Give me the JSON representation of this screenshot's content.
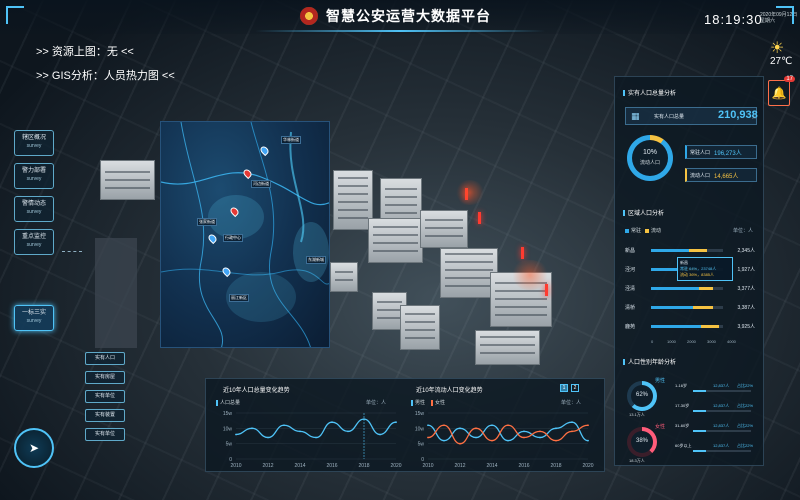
{
  "header": {
    "title": "智慧公安运营大数据平台",
    "time": "18:19:30",
    "date_line1": "2020年09月12日",
    "date_line2": "星期六",
    "temperature": "27℃",
    "alert_count": "17"
  },
  "info": {
    "resource_line": ">> 资源上图：无 <<",
    "gis_line": ">> GIS分析：人员热力图 <<"
  },
  "left_nav": [
    {
      "label": "辖区概况",
      "sub": "survey"
    },
    {
      "label": "警力部署",
      "sub": "survey"
    },
    {
      "label": "警情动态",
      "sub": "survey"
    },
    {
      "label": "重点监控",
      "sub": "survey"
    },
    {
      "label": "一标三实",
      "sub": "survey"
    }
  ],
  "sub_nav": [
    "实有人口",
    "实有房屋",
    "实有单位",
    "实有装置",
    "实有单位"
  ],
  "map": {
    "labels": [
      "华林街道",
      "河边街道",
      "张家街道",
      "行政中心",
      "东湖新城",
      "丽江新区"
    ]
  },
  "charts": {
    "left": {
      "title": "近10年人口总量变化趋势",
      "legend": "人口总量",
      "unit": "单位：人",
      "y_ticks": [
        "15w",
        "10w",
        "5w",
        "0"
      ],
      "x_ticks": [
        "2010",
        "2012",
        "2014",
        "2016",
        "2018",
        "2020"
      ]
    },
    "right": {
      "title": "近10年流动人口变化趋势",
      "legend_male": "男性",
      "legend_female": "女性",
      "unit": "单位：人",
      "page1": "1",
      "page2": "2",
      "y_ticks": [
        "15w",
        "10w",
        "5w",
        "0"
      ],
      "x_ticks": [
        "2010",
        "2012",
        "2014",
        "2016",
        "2018",
        "2020"
      ]
    }
  },
  "right_panel": {
    "total_title": "实有人口总量分析",
    "total_label": "实有人口总量",
    "total_value": "210,938",
    "total_unit": "人",
    "floating_pct": "10%",
    "floating_label": "流动人口",
    "resident_label": "常驻人口",
    "resident_value": "196,273人",
    "floating_label2": "流动人口",
    "floating_value": "14,665人",
    "region_title": "区域人口分析",
    "region_legend_a": "常驻",
    "region_legend_b": "流动",
    "region_unit": "单位：人",
    "regions": [
      {
        "name": "新昌",
        "value": "2,345人"
      },
      {
        "name": "泾河",
        "value": "1,927人"
      },
      {
        "name": "泾清",
        "value": "3,377人"
      },
      {
        "name": "清桥",
        "value": "3,387人"
      },
      {
        "name": "鹿苑",
        "value": "3,925人"
      }
    ],
    "region_axis": [
      "0",
      "1000",
      "2000",
      "3000",
      "4000"
    ],
    "tooltip": {
      "name": "新昌",
      "line1": "常驻  64%，23748人",
      "line2": "流动  36%，8385人"
    },
    "gender_title": "人口性别年龄分析",
    "male_label": "男性",
    "male_pct": "62%",
    "male_count": "13.1万人",
    "female_label": "女性",
    "female_pct": "38%",
    "female_count": "18.3万人",
    "age_rows": [
      {
        "range": "1-16岁",
        "value": "12,837人",
        "pct": "占比22%"
      },
      {
        "range": "17-30岁",
        "value": "12,837人",
        "pct": "占比22%"
      },
      {
        "range": "31-60岁",
        "value": "12,837人",
        "pct": "占比22%"
      },
      {
        "range": "60岁以上",
        "value": "12,837人",
        "pct": "占比22%"
      }
    ]
  },
  "chart_data": [
    {
      "type": "line",
      "title": "近10年人口总量变化趋势",
      "x": [
        2010,
        2011,
        2012,
        2013,
        2014,
        2015,
        2016,
        2017,
        2018,
        2019,
        2020
      ],
      "series": [
        {
          "name": "人口总量",
          "values": [
            8,
            10,
            7,
            11,
            9,
            7,
            12,
            9,
            13,
            8,
            12
          ]
        }
      ],
      "ylim": [
        0,
        15
      ],
      "ylabel": "单位：人"
    },
    {
      "type": "line",
      "title": "近10年流动人口变化趋势",
      "x": [
        2010,
        2011,
        2012,
        2013,
        2014,
        2015,
        2016,
        2017,
        2018,
        2019,
        2020
      ],
      "series": [
        {
          "name": "男性",
          "values": [
            11,
            6,
            10,
            7,
            11,
            6,
            9,
            7,
            10,
            12,
            6
          ]
        },
        {
          "name": "女性",
          "values": [
            7,
            11,
            5,
            10,
            6,
            11,
            7,
            9,
            6,
            9,
            11
          ]
        }
      ],
      "ylim": [
        0,
        15
      ],
      "ylabel": "单位：人"
    }
  ]
}
